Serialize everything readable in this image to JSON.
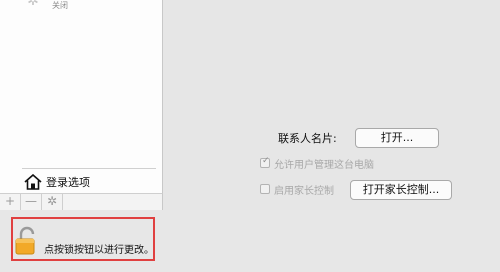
{
  "sidebar": {
    "user_status": "关闭",
    "login_options_label": "登录选项",
    "toolbar": {
      "add_symbol": "+",
      "remove_symbol": "—",
      "settings_symbol": "✲"
    }
  },
  "settings": {
    "contact_card_label": "联系人名片:",
    "open_button_label": "打开...",
    "allow_admin_label": "允许用户管理这台电脑",
    "allow_admin_checked": true,
    "enable_parental_label": "启用家长控制",
    "enable_parental_checked": false,
    "open_parental_button_label": "打开家长控制..."
  },
  "lock": {
    "label": "点按锁按钮以进行更改。",
    "icon": "lock-icon"
  },
  "colors": {
    "highlight_border": "#e04040",
    "lock_body": "#f2a928"
  }
}
